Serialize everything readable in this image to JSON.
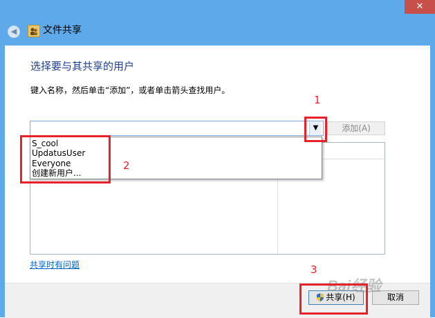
{
  "window": {
    "title": "文件共享",
    "close_glyph": "✕",
    "back_glyph": "◀",
    "icon_glyph": "👥"
  },
  "main": {
    "heading": "选择要与其共享的用户",
    "instruction": "键入名称，然后单击“添加”，或者单击箭头查找用户。",
    "combo_value": "",
    "dropdown_arrow_glyph": "▼",
    "add_button": "添加(A)",
    "dropdown_items": [
      "S_cool",
      "UpdatusUser",
      "Everyone",
      "创建新用户..."
    ],
    "help_link": "共享时有问题"
  },
  "footer": {
    "share_button": "共享(H)",
    "cancel_button": "取消"
  },
  "annotations": {
    "label_1": "1",
    "label_2": "2",
    "label_3": "3",
    "color": "#e8202a"
  },
  "watermark": {
    "text": "Bai经验"
  },
  "colors": {
    "frame": "#5ea9ea",
    "close": "#c7504a",
    "heading": "#1f3f8f",
    "link": "#0066cc"
  }
}
